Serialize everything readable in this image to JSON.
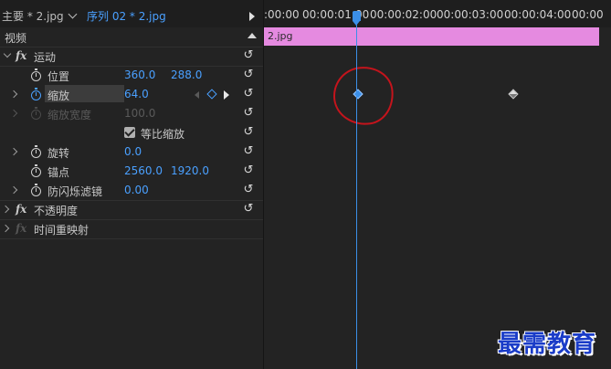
{
  "header": {
    "main_tab": "主要 * 2.jpg",
    "sequence_tab": "序列 02 * 2.jpg"
  },
  "ruler": {
    "labels": [
      ":00:00",
      "00:00:01:00",
      "00:00:02:00",
      "00:00:03:00",
      "00:00:04:00",
      "00:00"
    ]
  },
  "section": {
    "video_label": "视频"
  },
  "effects": {
    "motion": "运动",
    "position_label": "位置",
    "position_x": "360.0",
    "position_y": "288.0",
    "scale_label": "缩放",
    "scale_value": "64.0",
    "scale_width_label": "缩放宽度",
    "scale_width_value": "100.0",
    "uniform_scale_label": "等比缩放",
    "rotation_label": "旋转",
    "rotation_value": "0.0",
    "anchor_label": "锚点",
    "anchor_x": "2560.0",
    "anchor_y": "1920.0",
    "antiflicker_label": "防闪烁滤镜",
    "antiflicker_value": "0.00",
    "opacity": "不透明度",
    "time_remap": "时间重映射"
  },
  "timeline": {
    "clip_name": "2.jpg"
  },
  "watermark": "最需教育",
  "colors": {
    "accent": "#4aa0ff",
    "clip": "#e58ae0",
    "annotation": "#c4141c"
  }
}
